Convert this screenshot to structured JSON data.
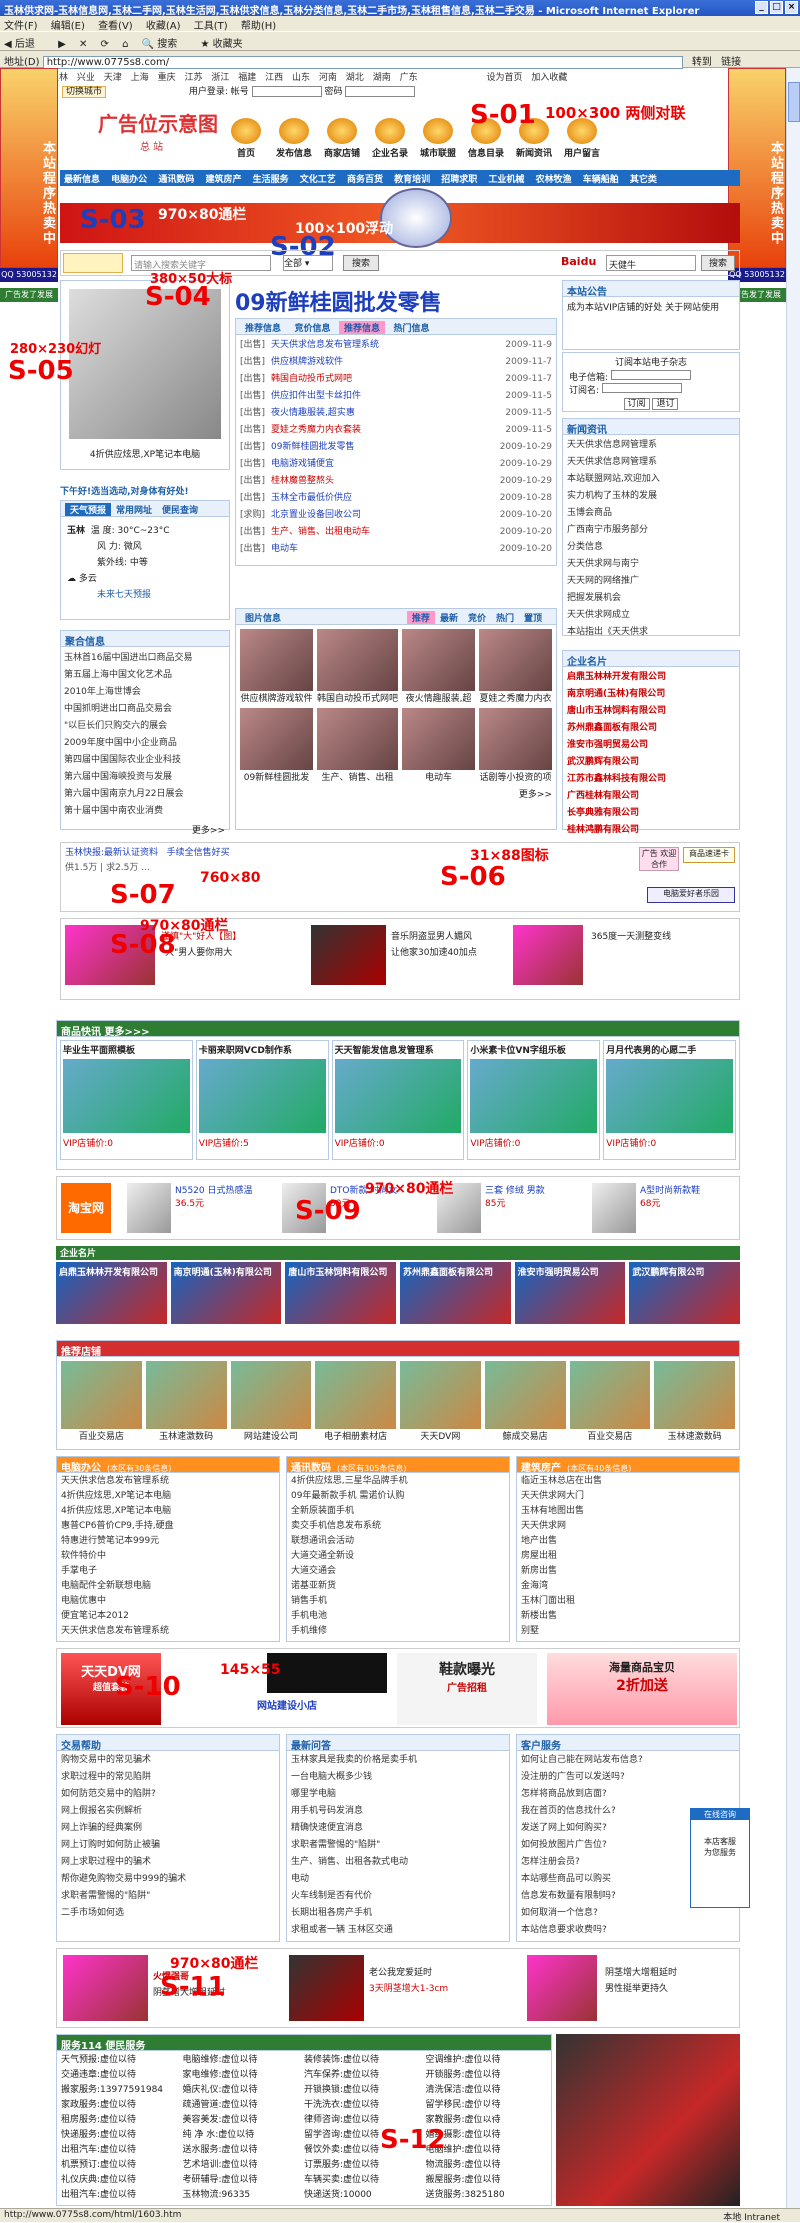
{
  "window": {
    "title": "玉林供求网-玉林信息网,玉林二手网,玉林生活网,玉林供求信息,玉林分类信息,玉林二手市场,玉林租售信息,玉林二手交易 - Microsoft Internet Explorer"
  },
  "menu": [
    "文件(F)",
    "编辑(E)",
    "查看(V)",
    "收藏(A)",
    "工具(T)",
    "帮助(H)"
  ],
  "toolbar": {
    "back": "后退",
    "search": "搜索",
    "favorites": "收藏夹"
  },
  "address": {
    "label": "地址(D)",
    "url": "http://www.0775s8.com/",
    "go": "转到",
    "links": "链接"
  },
  "cities": [
    "玉林",
    "兴业",
    "天津",
    "上海",
    "重庆",
    "江苏",
    "浙江",
    "福建",
    "江西",
    "山东",
    "河南",
    "湖北",
    "湖南",
    "广东"
  ],
  "site": {
    "switch_city": "切换城市",
    "login_user": "用户登录: 帐号",
    "pwd": "密码",
    "home_link": "设为首页",
    "fav": "加入收藏",
    "logo": "广告位示意图",
    "logo_sub": "总 站",
    "icons": [
      "首页",
      "发布信息",
      "商家店铺",
      "企业名录",
      "城市联盟",
      "信息目录",
      "新闻资讯",
      "用户留言"
    ],
    "categories": [
      "最新信息",
      "电脑办公",
      "通讯数码",
      "建筑房产",
      "生活服务",
      "文化工艺",
      "商务百货",
      "教育培训",
      "招聘求职",
      "工业机械",
      "农林牧渔",
      "车辆船舶",
      "其它类"
    ]
  },
  "annotations": {
    "s01": "S-01",
    "s01_desc": "100×300 两侧对联",
    "s02": "S-02",
    "s02_desc": "100×100浮动",
    "s03": "S-03",
    "s03_desc": "970×80通栏",
    "s04": "S-04",
    "s04_desc": "380×50大标",
    "s05": "S-05",
    "s05_desc": "280×230幻灯",
    "s06": "S-06",
    "s06_desc": "31×88图标",
    "s07": "S-07",
    "s07_desc": "760×80",
    "s08": "S-08",
    "s08_desc": "970×80通栏",
    "s09": "S-09",
    "s09_desc": "970×80通栏",
    "s10": "S-10",
    "s10_desc": "145×55",
    "s11": "S-11",
    "s11_desc": "970×80通栏",
    "s12": "S-12",
    "s12_desc": "250×250"
  },
  "side_ad": {
    "text": "本站程序热卖中",
    "qq": "QQ 53005132"
  },
  "slogan": "09新鲜桂圆批发零售",
  "latest": {
    "tabs": [
      "推荐信息",
      "竞价信息",
      "推荐信息",
      "热门信息"
    ],
    "items": [
      {
        "tag": "[出售]",
        "t": "天天供求信息发布管理系统",
        "d": "2009-11-9"
      },
      {
        "tag": "[出售]",
        "t": "供应棋牌游戏软件",
        "d": "2009-11-7"
      },
      {
        "tag": "[出售]",
        "t": "韩国自动投币式网吧",
        "d": "2009-11-7"
      },
      {
        "tag": "[出售]",
        "t": "供应扣件出型卡丝扣件",
        "d": "2009-11-5"
      },
      {
        "tag": "[出售]",
        "t": "夜火情趣服装,超实惠",
        "d": "2009-11-5"
      },
      {
        "tag": "[出售]",
        "t": "夏娃之秀魔力内衣套装",
        "d": "2009-11-5"
      },
      {
        "tag": "[出售]",
        "t": "09新鲜桂圆批发零售",
        "d": "2009-10-29"
      },
      {
        "tag": "[出售]",
        "t": "电脑游戏铺便宜",
        "d": "2009-10-29"
      },
      {
        "tag": "[出售]",
        "t": "桂林魔兽整熬头",
        "d": "2009-10-29"
      },
      {
        "tag": "[出售]",
        "t": "玉林全市最低价供应",
        "d": "2009-10-28"
      },
      {
        "tag": "[求购]",
        "t": "北京置业设备回收公司",
        "d": "2009-10-20"
      },
      {
        "tag": "[出售]",
        "t": "生产、销售、出租电动车",
        "d": "2009-10-20"
      },
      {
        "tag": "[出售]",
        "t": "电动车",
        "d": "2009-10-20"
      }
    ]
  },
  "notice": {
    "title": "本站公告",
    "text": "成为本站VIP店铺的好处 关于网站使用"
  },
  "subscribe": {
    "title": "订阅本站电子杂志",
    "email": "电子信箱:",
    "name": "订阅名:",
    "btn1": "订阅",
    "btn2": "退订"
  },
  "news": {
    "title": "新闻资讯",
    "items": [
      "天天供求信息网管理系",
      "天天供求信息网管理系",
      "本站联盟网站,欢迎加入",
      "实力机构了玉林的发展",
      "玉博会商品",
      "广西南宁市服务部分",
      "分类信息",
      "天天供求网与南宁",
      "天天网的网络推广",
      "把握发展机会",
      "天天供求网成立",
      "本站指出《天天供求"
    ]
  },
  "weather": {
    "title": "天气预报",
    "tabs": [
      "天气预报",
      "常用网址",
      "便民查询"
    ],
    "city": "玉林",
    "temp_label": "温 度:",
    "temp": "30°C~23°C",
    "wind_label": "风 力:",
    "wind": "微风",
    "uv": "紫外线: 中等",
    "cond": "多云",
    "future": "未来七天预报"
  },
  "slider_caption": "4折供应炫思,XP笔记本电脑",
  "tip": "下午好!选当选动,对身体有好处!",
  "company": {
    "title": "企业名片",
    "items": [
      "启鼎玉林林开发有限公司",
      "南京明通(玉林)有限公司",
      "唐山市玉林饲料有限公司",
      "苏州鼎鑫面板有限公司",
      "淮安市强明贸易公司",
      "武汉鹏辉有限公司",
      "江苏市鑫林科技有限公司",
      "广西桂林有限公司",
      "长亭典雅有限公司",
      "桂林鸿鹏有限公司"
    ]
  },
  "photos": {
    "title": "图片信息",
    "tabs": [
      "推荐",
      "最新",
      "竞价",
      "热门",
      "置顶"
    ],
    "captions": [
      "供应棋牌游戏软件",
      "韩国自动投币式网吧",
      "夜火情趣服装,超",
      "夏娃之秀魔力内衣",
      "09新鲜桂圆批发",
      "生产、销售、出租",
      "电动车",
      "话剧等小投资的项"
    ]
  },
  "biz": {
    "title": "聚合信息",
    "items": [
      "玉林首16届中国进出口商品交易",
      "第五届上海中国文化艺术品",
      "2010年上海世博会",
      "中国抓明进出口商品交易会",
      "\"以巨长们只购交六的展会",
      "2009年度中国中小企业商品",
      "第四届中国国际农业企业科技",
      "第六届中国海峡投资与发展",
      "第六届中国南京九月22日展会",
      "第十届中国中南农业消费"
    ],
    "more": "更多>>"
  },
  "marquee": {
    "l1": "玉林快报:最新认证资料",
    "l2": "玉林供求网",
    "l3": "手续全信售好买",
    "stat": "供1.5万 | 求2.5万 ...",
    "partner1": "广告\n欢迎合作",
    "partner2": "商品速递卡",
    "partner3": "电脑爱好者乐园"
  },
  "ads_row1": [
    {
      "t": "谨慎\"大\"好人【图】",
      "s": "\"大\"男人要你用大"
    },
    {
      "t": "音乐阴盗显男人媚风",
      "s": "让他家30加速40加点"
    },
    {
      "t": "365度一天测整变线"
    }
  ],
  "vip": {
    "title": "商品快讯",
    "more": "更多>>>",
    "items": [
      {
        "t": "毕业生平面照模板",
        "p": "VIP店铺价:0"
      },
      {
        "t": "卡丽来职网VCD制作系",
        "p": "VIP店铺价:5"
      },
      {
        "t": "天天智能发信息发管理系",
        "p": "VIP店铺价:0"
      },
      {
        "t": "小米素卡位VN字组乐板",
        "p": "VIP店铺价:0"
      },
      {
        "t": "月月代表男的心愿二手",
        "p": "VIP店铺价:0"
      }
    ]
  },
  "taobao": {
    "logo": "淘宝网",
    "items": [
      {
        "t": "N5520 日式热感温",
        "p": "36.5元"
      },
      {
        "t": "DTO新款 时尚女",
        "p": "59元"
      },
      {
        "t": "三套 修绒 男款",
        "p": "85元"
      },
      {
        "t": "A型时尚新款鞋",
        "p": "68元"
      }
    ]
  },
  "biz2": {
    "title": "企业名片"
  },
  "shops": {
    "title": "推荐店铺",
    "items": [
      "百业交易店",
      "玉林速激数码",
      "网站建设公司",
      "电子相册素材店",
      "天天DV网",
      "鲸成交易店",
      "百业交易店",
      "玉林速激数码"
    ]
  },
  "col3": [
    {
      "title": "电脑办公",
      "sub": "(本区有30条信息)",
      "items": [
        "天天供求信息发布管理系统",
        "4折供应炫思,XP笔记本电脑",
        "4折供应炫思,XP笔记本电脑",
        "惠普CP6普价CP9,手持,硬盘",
        "特惠进行赞笔记本999元",
        "软件特价中",
        "手掌电子",
        "电脑配件全新联想电脑",
        "电脑优惠中",
        "便宜笔记本2012",
        "天天供求信息发布管理系统"
      ]
    },
    {
      "title": "通讯数码",
      "sub": "(本区有305条信息)",
      "items": [
        "4折供应炫思,三星华品牌手机",
        "09年最新款手机 需诺价认购",
        "全新原装面手机",
        "卖交手机信息发布系统",
        "联想通讯会活动",
        "大道交通全新设",
        "大道交通会",
        "诺基亚新货",
        "销售手机",
        "手机电池",
        "手机维修"
      ]
    },
    {
      "title": "建筑房产",
      "sub": "(本区有40条信息)",
      "items": [
        "临近玉林总店在出售",
        "天天供求网大门",
        "玉林有地图出售",
        "天天供求网",
        "地产出售",
        "房屋出租",
        "新房出售",
        "金海湾",
        "玉林门面出租",
        "新楼出售",
        "别墅"
      ]
    }
  ],
  "bottom_ads": {
    "dv": "天天DV网",
    "dv_sub": "超值套装",
    "shoe": "鞋款曝光",
    "shoe_sub": "广告招租",
    "bag": "海量商品宝贝",
    "bag_sub": "2折加送",
    "brand": "网站建设小店"
  },
  "bottom_cols": [
    {
      "title": "交易帮助",
      "items": [
        "购物交易中的常见骗术",
        "求职过程中的常见陷阱",
        "如何防范交易中的陷阱?",
        "网上假报名实例解析",
        "网上诈骗的经典案例",
        "网上订购时如何防止被骗",
        "网上求职过程中的骗术",
        "帮你避免购物交易中999的骗术",
        "求职者需警惕的\"陷阱\"",
        "二手市场如何选"
      ]
    },
    {
      "title": "最新问答",
      "items": [
        "玉林家具是我卖的价格是卖手机",
        "一台电脑大概多少钱",
        "哪里学电脑",
        "用手机号码发消息",
        "精确快速便宜消息",
        "求职者需警惕的\"陷阱\"",
        "生产、销售、出租各款式电动",
        "电动",
        "火车线制是否有代价",
        "长期出租各房产手机",
        "求租或者一辆 玉林区交通"
      ]
    },
    {
      "title": "客户服务",
      "items": [
        "如何让自己能在网站发布信息?",
        "没注册的广告可以发送吗?",
        "怎样将商品放到店面?",
        "我在首页的信息找什么?",
        "发送了网上如何购买?",
        "如何投放图片广告位?",
        "怎样注册会员?",
        "本站哪些商品可以购买",
        "信息发布数量有限制吗?",
        "如何取消一个信息?",
        "本站信息要求收费吗?"
      ]
    }
  ],
  "float_ad": {
    "title": "在线咨询",
    "sub": "本店客服\n为您服务"
  },
  "ads_row2": [
    {
      "t": "火爆强哥",
      "s": "阴茎增大增粗延时"
    },
    {
      "t": "老公我宠爱延时",
      "s": "3天阴茎增大1-3cm"
    },
    {
      "t": "阴茎增大增粗延时",
      "s": "男性挺举更持久"
    }
  ],
  "links": {
    "title": "服务114 便民服务",
    "rows": [
      [
        "天气预报:虚位以待",
        "电脑维修:虚位以待",
        "装修装饰:虚位以待",
        "空调维护:虚位以待"
      ],
      [
        "交通违章:虚位以待",
        "家电维修:虚位以待",
        "汽车保养:虚位以待",
        "开锁服务:虚位以待"
      ],
      [
        "搬家服务:13977591984",
        "婚庆礼仪:虚位以待",
        "开锁换锁:虚位以待",
        "清洗保洁:虚位以待"
      ],
      [
        "家政服务:虚位以待",
        "疏通管道:虚位以待",
        "干洗洗衣:虚位以待",
        "留学移民:虚位以待"
      ],
      [
        "租房服务:虚位以待",
        "美容美发:虚位以待",
        "律师咨询:虚位以待",
        "家教服务:虚位以待"
      ],
      [
        "快递服务:虚位以待",
        "纯 净 水:虚位以待",
        "留学咨询:虚位以待",
        "婚纱摄影:虚位以待"
      ],
      [
        "出租汽车:虚位以待",
        "送水服务:虚位以待",
        "餐饮外卖:虚位以待",
        "电脑维护:虚位以待"
      ],
      [
        "机票预订:虚位以待",
        "艺术培训:虚位以待",
        "订票服务:虚位以待",
        "物流服务:虚位以待"
      ],
      [
        "礼仪庆典:虚位以待",
        "考研辅导:虚位以待",
        "车辆买卖:虚位以待",
        "搬屋服务:虚位以待"
      ],
      [
        "出租汽车:虚位以待",
        "玉林物流:96335",
        "快递送货:10000",
        "送货服务:3825180"
      ]
    ]
  },
  "status": {
    "url": "http://www.0775s8.com/html/1603.htm",
    "zone": "本地 Intranet"
  }
}
